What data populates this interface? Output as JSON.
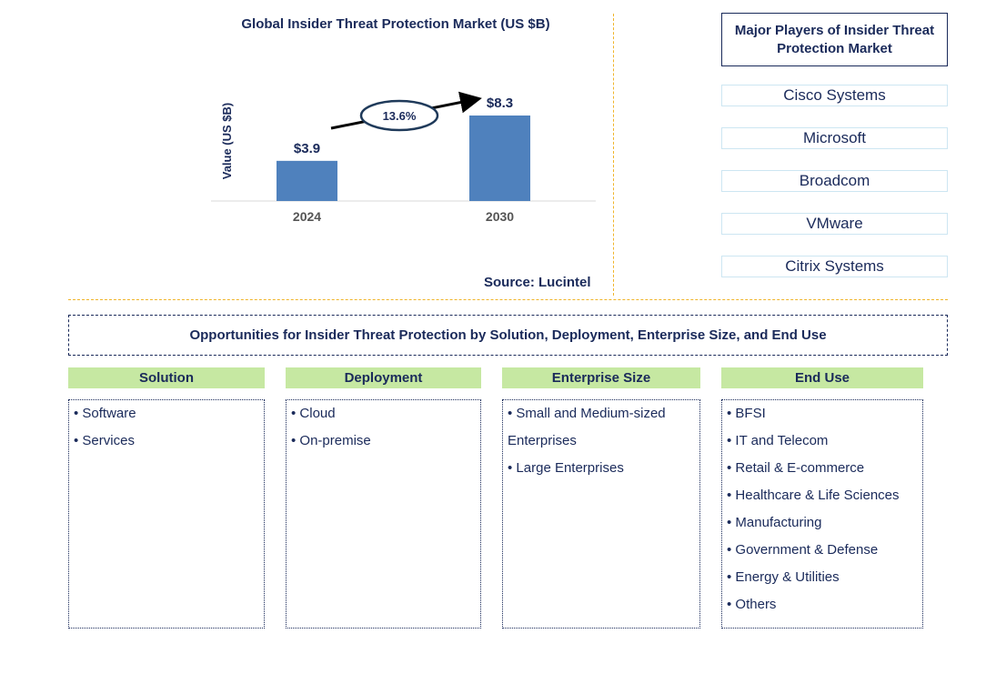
{
  "chart_data": {
    "type": "bar",
    "title": "Global Insider Threat Protection Market (US $B)",
    "ylabel": "Value (US $B)",
    "categories": [
      "2024",
      "2030"
    ],
    "values": [
      3.9,
      8.3
    ],
    "data_labels": [
      "$3.9",
      "$8.3"
    ],
    "annotation": "13.6%",
    "bar_color": "#4f81bd",
    "source": "Source: Lucintel"
  },
  "players": {
    "title": "Major Players of Insider Threat Protection Market",
    "items": [
      "Cisco Systems",
      "Microsoft",
      "Broadcom",
      "VMware",
      "Citrix Systems"
    ]
  },
  "opportunities": {
    "title": "Opportunities for Insider Threat Protection by Solution, Deployment, Enterprise Size, and End Use",
    "columns": [
      {
        "header": "Solution",
        "items": [
          "Software",
          "Services"
        ]
      },
      {
        "header": "Deployment",
        "items": [
          "Cloud",
          "On-premise"
        ]
      },
      {
        "header": "Enterprise Size",
        "items": [
          "Small and Medium-sized Enterprises",
          "Large Enterprises"
        ]
      },
      {
        "header": "End Use",
        "items": [
          "BFSI",
          "IT and Telecom",
          "Retail & E-commerce",
          "Healthcare & Life Sciences",
          "Manufacturing",
          "Government & Defense",
          "Energy & Utilities",
          "Others"
        ]
      }
    ]
  }
}
